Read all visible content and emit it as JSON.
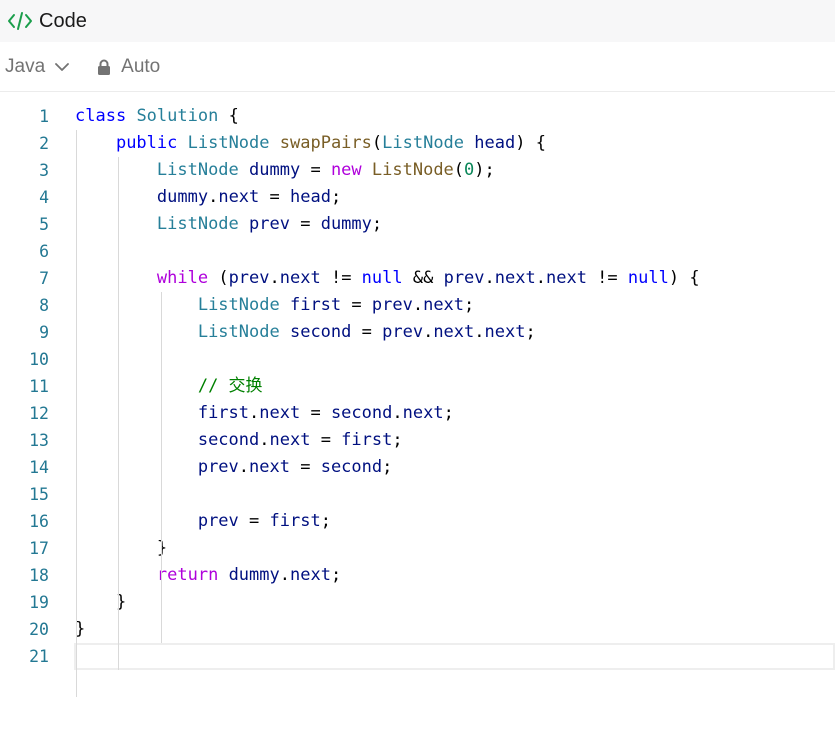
{
  "header": {
    "title": "Code",
    "icon": "code-brackets-icon"
  },
  "toolbar": {
    "language": "Java",
    "mode": "Auto",
    "lock_icon": "lock-icon"
  },
  "colors": {
    "line_number": "#237893",
    "keyword": "#0000ff",
    "control": "#af00db",
    "type": "#267f99",
    "function": "#795e26",
    "variable": "#001080",
    "number": "#098658",
    "comment": "#008000",
    "plain": "#000000"
  },
  "editor": {
    "lines": [
      {
        "n": "1",
        "tokens": [
          [
            "kw",
            "class"
          ],
          [
            "plain",
            " "
          ],
          [
            "typ",
            "Solution"
          ],
          [
            "plain",
            " {"
          ]
        ]
      },
      {
        "n": "2",
        "tokens": [
          [
            "plain",
            "    "
          ],
          [
            "kw",
            "public"
          ],
          [
            "plain",
            " "
          ],
          [
            "typ",
            "ListNode"
          ],
          [
            "plain",
            " "
          ],
          [
            "fn",
            "swapPairs"
          ],
          [
            "plain",
            "("
          ],
          [
            "typ",
            "ListNode"
          ],
          [
            "plain",
            " "
          ],
          [
            "var",
            "head"
          ],
          [
            "plain",
            ") {"
          ]
        ]
      },
      {
        "n": "3",
        "tokens": [
          [
            "plain",
            "        "
          ],
          [
            "typ",
            "ListNode"
          ],
          [
            "plain",
            " "
          ],
          [
            "var",
            "dummy"
          ],
          [
            "plain",
            " = "
          ],
          [
            "ctl",
            "new"
          ],
          [
            "plain",
            " "
          ],
          [
            "fn",
            "ListNode"
          ],
          [
            "plain",
            "("
          ],
          [
            "num",
            "0"
          ],
          [
            "plain",
            ");"
          ]
        ]
      },
      {
        "n": "4",
        "tokens": [
          [
            "plain",
            "        "
          ],
          [
            "var",
            "dummy"
          ],
          [
            "plain",
            "."
          ],
          [
            "var",
            "next"
          ],
          [
            "plain",
            " = "
          ],
          [
            "var",
            "head"
          ],
          [
            "plain",
            ";"
          ]
        ]
      },
      {
        "n": "5",
        "tokens": [
          [
            "plain",
            "        "
          ],
          [
            "typ",
            "ListNode"
          ],
          [
            "plain",
            " "
          ],
          [
            "var",
            "prev"
          ],
          [
            "plain",
            " = "
          ],
          [
            "var",
            "dummy"
          ],
          [
            "plain",
            ";"
          ]
        ]
      },
      {
        "n": "6",
        "tokens": []
      },
      {
        "n": "7",
        "tokens": [
          [
            "plain",
            "        "
          ],
          [
            "ctl",
            "while"
          ],
          [
            "plain",
            " ("
          ],
          [
            "var",
            "prev"
          ],
          [
            "plain",
            "."
          ],
          [
            "var",
            "next"
          ],
          [
            "plain",
            " != "
          ],
          [
            "kw",
            "null"
          ],
          [
            "plain",
            " && "
          ],
          [
            "var",
            "prev"
          ],
          [
            "plain",
            "."
          ],
          [
            "var",
            "next"
          ],
          [
            "plain",
            "."
          ],
          [
            "var",
            "next"
          ],
          [
            "plain",
            " != "
          ],
          [
            "kw",
            "null"
          ],
          [
            "plain",
            ") {"
          ]
        ]
      },
      {
        "n": "8",
        "tokens": [
          [
            "plain",
            "            "
          ],
          [
            "typ",
            "ListNode"
          ],
          [
            "plain",
            " "
          ],
          [
            "var",
            "first"
          ],
          [
            "plain",
            " = "
          ],
          [
            "var",
            "prev"
          ],
          [
            "plain",
            "."
          ],
          [
            "var",
            "next"
          ],
          [
            "plain",
            ";"
          ]
        ]
      },
      {
        "n": "9",
        "tokens": [
          [
            "plain",
            "            "
          ],
          [
            "typ",
            "ListNode"
          ],
          [
            "plain",
            " "
          ],
          [
            "var",
            "second"
          ],
          [
            "plain",
            " = "
          ],
          [
            "var",
            "prev"
          ],
          [
            "plain",
            "."
          ],
          [
            "var",
            "next"
          ],
          [
            "plain",
            "."
          ],
          [
            "var",
            "next"
          ],
          [
            "plain",
            ";"
          ]
        ]
      },
      {
        "n": "10",
        "tokens": []
      },
      {
        "n": "11",
        "tokens": [
          [
            "plain",
            "            "
          ],
          [
            "cmt",
            "// 交换"
          ]
        ]
      },
      {
        "n": "12",
        "tokens": [
          [
            "plain",
            "            "
          ],
          [
            "var",
            "first"
          ],
          [
            "plain",
            "."
          ],
          [
            "var",
            "next"
          ],
          [
            "plain",
            " = "
          ],
          [
            "var",
            "second"
          ],
          [
            "plain",
            "."
          ],
          [
            "var",
            "next"
          ],
          [
            "plain",
            ";"
          ]
        ]
      },
      {
        "n": "13",
        "tokens": [
          [
            "plain",
            "            "
          ],
          [
            "var",
            "second"
          ],
          [
            "plain",
            "."
          ],
          [
            "var",
            "next"
          ],
          [
            "plain",
            " = "
          ],
          [
            "var",
            "first"
          ],
          [
            "plain",
            ";"
          ]
        ]
      },
      {
        "n": "14",
        "tokens": [
          [
            "plain",
            "            "
          ],
          [
            "var",
            "prev"
          ],
          [
            "plain",
            "."
          ],
          [
            "var",
            "next"
          ],
          [
            "plain",
            " = "
          ],
          [
            "var",
            "second"
          ],
          [
            "plain",
            ";"
          ]
        ]
      },
      {
        "n": "15",
        "tokens": []
      },
      {
        "n": "16",
        "tokens": [
          [
            "plain",
            "            "
          ],
          [
            "var",
            "prev"
          ],
          [
            "plain",
            " = "
          ],
          [
            "var",
            "first"
          ],
          [
            "plain",
            ";"
          ]
        ]
      },
      {
        "n": "17",
        "tokens": [
          [
            "plain",
            "        }"
          ]
        ]
      },
      {
        "n": "18",
        "tokens": [
          [
            "plain",
            "        "
          ],
          [
            "ctl",
            "return"
          ],
          [
            "plain",
            " "
          ],
          [
            "var",
            "dummy"
          ],
          [
            "plain",
            "."
          ],
          [
            "var",
            "next"
          ],
          [
            "plain",
            ";"
          ]
        ]
      },
      {
        "n": "19",
        "tokens": [
          [
            "plain",
            "    }"
          ]
        ]
      },
      {
        "n": "20",
        "tokens": [
          [
            "plain",
            "}"
          ]
        ]
      },
      {
        "n": "21",
        "tokens": []
      }
    ],
    "current_line": "21"
  }
}
